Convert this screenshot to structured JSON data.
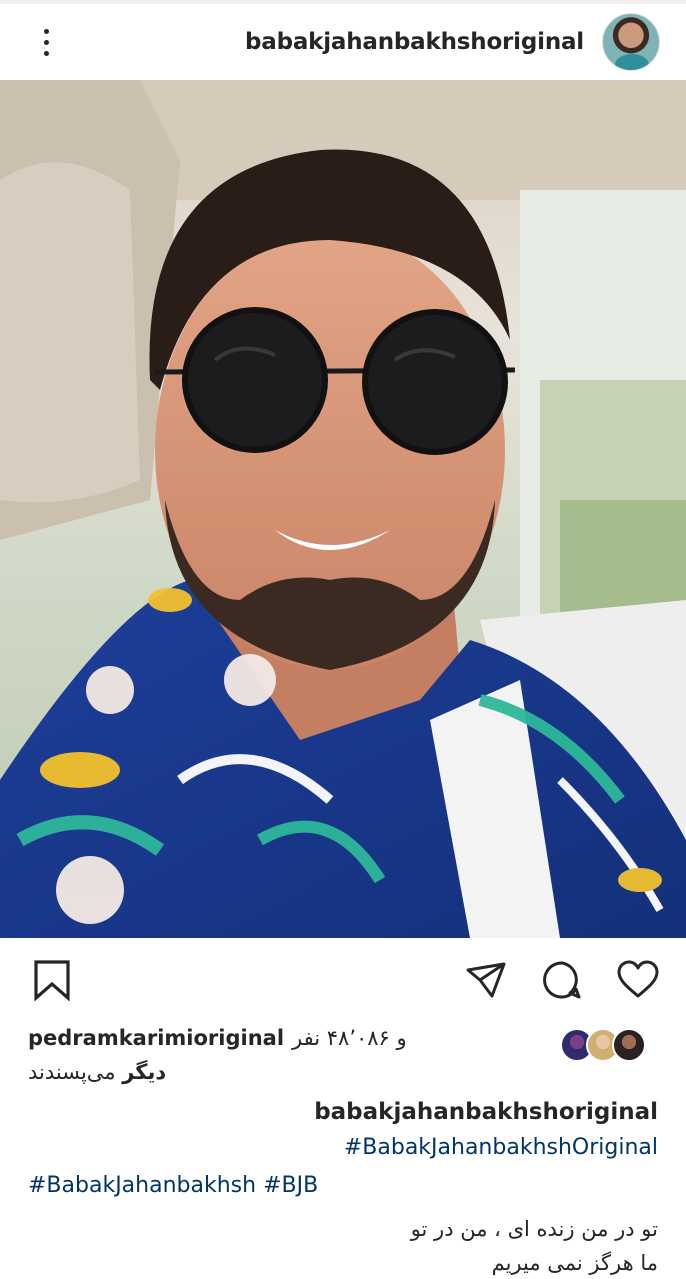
{
  "header": {
    "username": "babakjahanbakhshoriginal",
    "more_icon": "more-vertical-icon",
    "avatar_icon": "profile-avatar"
  },
  "post": {
    "image_alt": "selfie-photo"
  },
  "actions": {
    "save_icon": "bookmark-icon",
    "share_icon": "send-icon",
    "comment_icon": "comment-icon",
    "like_icon": "heart-icon"
  },
  "likes": {
    "username": "pedramkarimioriginal",
    "count_text": "و ۴۸٬۰۸۶ نفر",
    "others_bold": "دیگر",
    "others_rest": " می‌پسندند"
  },
  "caption": {
    "username": "babakjahanbakhshoriginal",
    "hashtag_1": "#BabakJahanbakhshOriginal",
    "hashtag_2": "#BabakJahanbakhsh",
    "hashtag_3": "#BJB",
    "line_1": "تو در من زنده ای ، من در تو",
    "line_2": "ما هرگز نمی میریم"
  },
  "colors": {
    "text": "#262626",
    "link": "#003569",
    "background": "#ffffff"
  }
}
